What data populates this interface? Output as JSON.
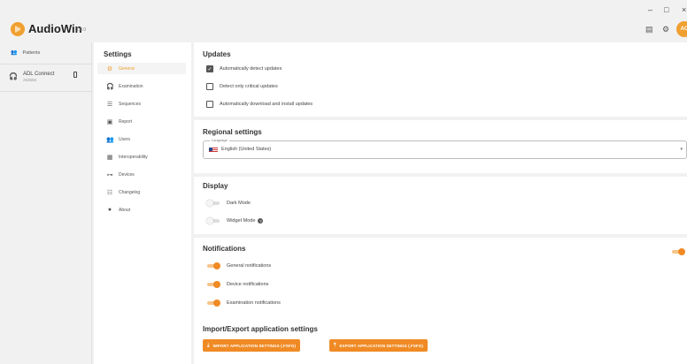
{
  "app": {
    "name": "AudioWin",
    "version": "1.0.0",
    "avatar_initials": "AC",
    "accent_color": "#f08a24"
  },
  "window": {
    "minimize": "–",
    "maximize": "□",
    "close": "×"
  },
  "toolbar": {
    "layout_icon": "layout-icon",
    "settings_icon": "gear-icon"
  },
  "sidebar": {
    "patients_label": "Patients",
    "device": {
      "name": "ADL Connect",
      "id": "253555"
    }
  },
  "settings_nav": {
    "title": "Settings",
    "items": [
      {
        "label": "General",
        "icon": "gear-icon",
        "active": true
      },
      {
        "label": "Examination",
        "icon": "headphones-icon"
      },
      {
        "label": "Sequences",
        "icon": "list-icon"
      },
      {
        "label": "Report",
        "icon": "report-icon"
      },
      {
        "label": "Users",
        "icon": "users-icon"
      },
      {
        "label": "Interoperability",
        "icon": "server-icon"
      },
      {
        "label": "Devices",
        "icon": "device-icon"
      },
      {
        "label": "Changelog",
        "icon": "changelog-icon"
      },
      {
        "label": "About",
        "icon": "info-icon"
      }
    ]
  },
  "updates": {
    "title": "Updates",
    "options": [
      {
        "label": "Automatically detect updates",
        "checked": true
      },
      {
        "label": "Detect only critical updates",
        "checked": false
      },
      {
        "label": "Automatically download and install updates",
        "checked": false
      }
    ]
  },
  "regional": {
    "title": "Regional settings",
    "language_legend": "Language",
    "language_value": "English (United States)"
  },
  "display": {
    "title": "Display",
    "dark_mode": {
      "label": "Dark Mode",
      "on": false
    },
    "widget_mode": {
      "label": "Widget Mode",
      "on": false
    }
  },
  "notifications": {
    "title": "Notifications",
    "master_on": true,
    "options": [
      {
        "label": "General notifications",
        "on": true
      },
      {
        "label": "Device notifications",
        "on": true
      },
      {
        "label": "Examination notifications",
        "on": true
      }
    ]
  },
  "import_export": {
    "title": "Import/Export application settings",
    "import_label": "IMPORT APPLICATION SETTINGS (.FSFG)",
    "export_label": "EXPORT APPLICATION SETTINGS (.FSFG)"
  }
}
